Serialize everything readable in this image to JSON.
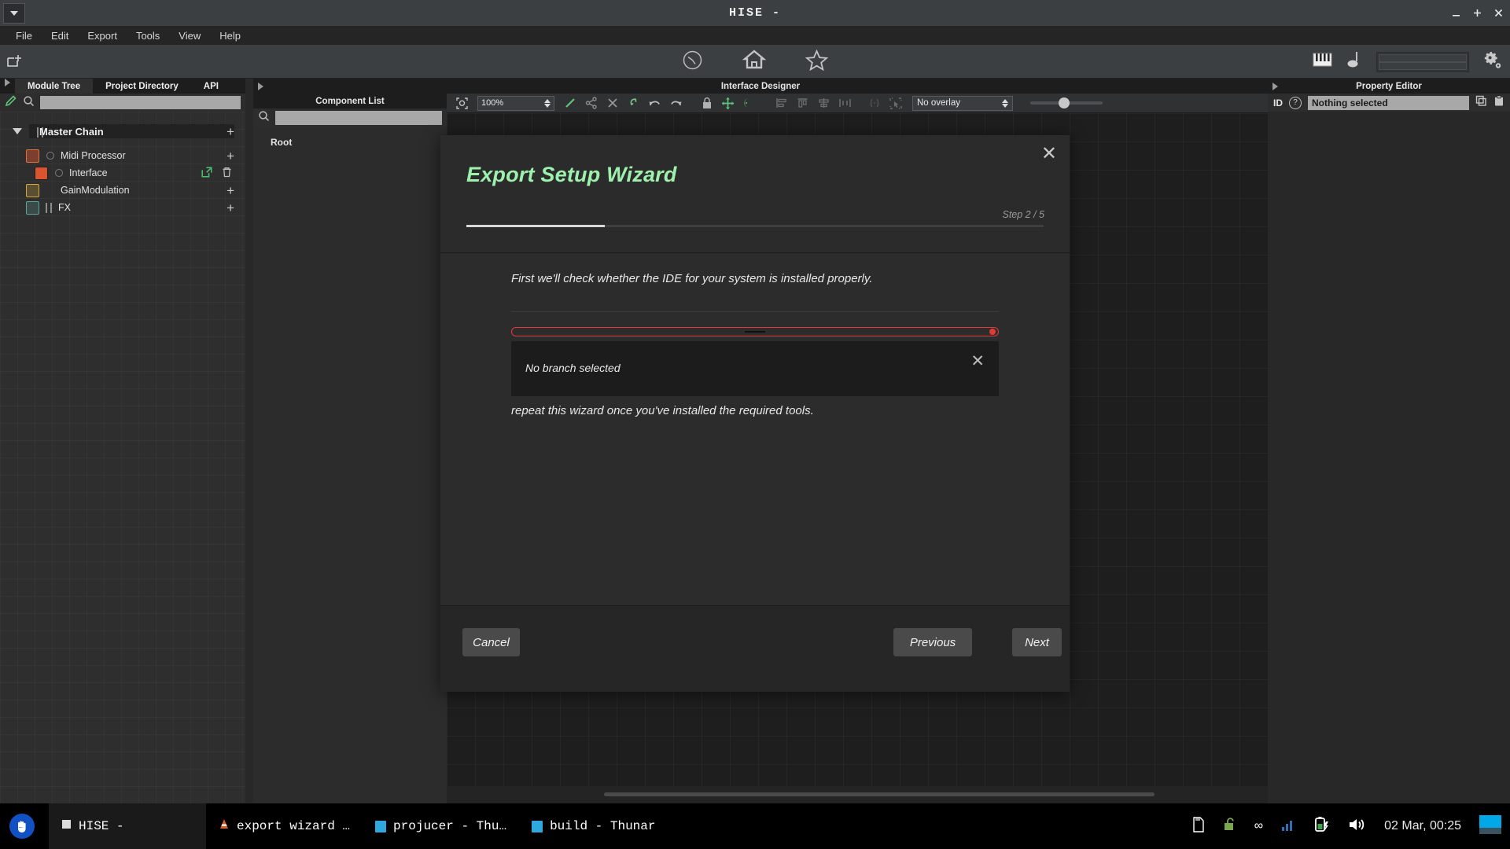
{
  "window": {
    "title": "HISE -",
    "minimize_icon": "minimize-icon",
    "maximize_icon": "maximize-icon",
    "close_icon": "close-icon"
  },
  "menubar": {
    "items": [
      "File",
      "Edit",
      "Export",
      "Tools",
      "View",
      "Help"
    ]
  },
  "toolbar": {
    "new_icon": "new-project-icon",
    "center_icons": [
      "gauge-icon",
      "home-icon",
      "star-icon"
    ],
    "right_icons": [
      "keyboard-icon",
      "metronome-icon"
    ],
    "settings_icon": "gear-icon"
  },
  "left_panel": {
    "tabs": [
      {
        "label": "Module Tree",
        "active": true
      },
      {
        "label": "Project Directory",
        "active": false
      },
      {
        "label": "API",
        "active": false
      }
    ],
    "pencil_icon": "pencil-icon",
    "search_icon": "search-icon",
    "search_value": "",
    "tree": [
      {
        "label": "Master Chain",
        "type": "chain",
        "indent": 0,
        "swatch": "",
        "has_plus": true
      },
      {
        "label": "Midi Processor",
        "type": "module",
        "indent": 1,
        "swatch": "#7a3f2e",
        "border": "#e26a3c",
        "has_plus": true,
        "radio": true
      },
      {
        "label": "Interface",
        "type": "module",
        "indent": 2,
        "swatch": "#d9542f",
        "border": "#1a1a1a",
        "has_plus": false,
        "radio": true,
        "open_icon": "open-external-icon",
        "delete_icon": "trash-icon"
      },
      {
        "label": "GainModulation",
        "type": "module",
        "indent": 1,
        "swatch": "#5a5030",
        "border": "#d4a841",
        "has_plus": true,
        "radio": false
      },
      {
        "label": "FX",
        "type": "module",
        "indent": 1,
        "swatch": "#3a4a48",
        "border": "#5fa39a",
        "has_plus": true,
        "radio": false
      }
    ]
  },
  "component_list": {
    "title": "Component List",
    "search_icon": "search-icon",
    "search_value": "",
    "root_label": "Root"
  },
  "interface_designer": {
    "title": "Interface Designer",
    "zoom_value": "100%",
    "overlay_value": "No overlay",
    "icons": [
      "zoom-to-fit-icon",
      "pencil-icon",
      "share-icon",
      "delete-x-icon",
      "undo-curved-icon",
      "undo-icon",
      "redo-icon",
      "lock-icon",
      "move-icon",
      "moon-icon",
      "align-left-icon",
      "align-top-icon",
      "align-center-icon",
      "distribute-icon",
      "grouping-icon",
      "select-all-icon"
    ]
  },
  "property_editor": {
    "title": "Property Editor",
    "id_label": "ID",
    "help_icon": "question-icon",
    "value": "Nothing selected",
    "copy_icon": "copy-icon",
    "paste_icon": "paste-icon"
  },
  "wizard": {
    "title": "Export Setup Wizard",
    "step_label": "Step 2 / 5",
    "progress_percent": 24,
    "close_icon": "close-icon",
    "line1": "First we'll check whether the IDE for your system is installed properly.",
    "line2": "repeat this wizard once you've installed the required tools.",
    "toast_message": "No branch selected",
    "toast_close_icon": "close-icon",
    "buttons": {
      "cancel": "Cancel",
      "previous": "Previous",
      "next": "Next"
    },
    "accent_color": "#9ef1ad",
    "error_color": "#e03a3a"
  },
  "taskbar": {
    "start_icon": "start-menu-icon",
    "tasks": [
      {
        "label": "HISE -",
        "icon": "window-icon",
        "active": true
      },
      {
        "label": "export wizard …",
        "icon": "vlc-icon",
        "active": false
      },
      {
        "label": "projucer - Thu…",
        "icon": "folder-icon",
        "active": false
      },
      {
        "label": "build - Thunar",
        "icon": "folder-icon",
        "active": false
      }
    ],
    "tray_icons": [
      "sd-card-icon",
      "unlocked-icon",
      "infinity-icon",
      "signal-icon",
      "battery-charging-icon",
      "volume-icon"
    ],
    "clock": "02 Mar, 00:25",
    "desktop_switcher_icon": "workspace-icon"
  }
}
